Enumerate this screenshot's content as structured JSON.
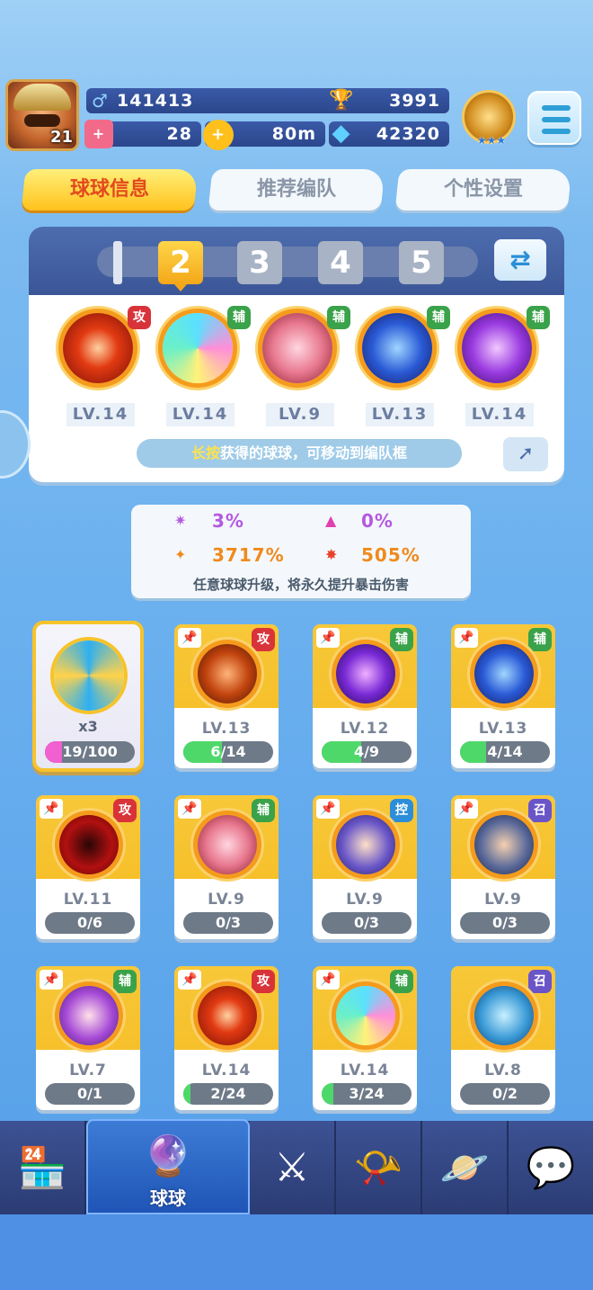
{
  "player": {
    "level": "21",
    "id": "141413",
    "trophies": "3991",
    "tickets": "28",
    "distance": "80m",
    "gems": "42320"
  },
  "tabs": [
    "球球信息",
    "推荐编队",
    "个性设置"
  ],
  "lineup": {
    "slots": [
      "1",
      "2",
      "3",
      "4",
      "5"
    ],
    "active_slot": "2",
    "balls": [
      {
        "type": "攻",
        "level": "LV.14"
      },
      {
        "type": "辅",
        "level": "LV.14"
      },
      {
        "type": "辅",
        "level": "LV.9"
      },
      {
        "type": "辅",
        "level": "LV.13"
      },
      {
        "type": "辅",
        "level": "LV.14"
      }
    ],
    "hint_highlight": "长按",
    "hint_text": "获得的球球，可移动到编队框"
  },
  "crit": {
    "stat1": "3%",
    "stat2": "0%",
    "stat3": "3717%",
    "stat4": "505%",
    "tip": "任意球球升级，将永久提升暴击伤害"
  },
  "special_card": {
    "count": "x3",
    "progress": "19/100"
  },
  "cards": [
    {
      "type": "攻",
      "level": "LV.13",
      "progress": "6/14",
      "ratio": 0.43
    },
    {
      "type": "辅",
      "level": "LV.12",
      "progress": "4/9",
      "ratio": 0.44
    },
    {
      "type": "辅",
      "level": "LV.13",
      "progress": "4/14",
      "ratio": 0.29
    },
    {
      "type": "攻",
      "level": "LV.11",
      "progress": "0/6",
      "ratio": 0
    },
    {
      "type": "辅",
      "level": "LV.9",
      "progress": "0/3",
      "ratio": 0
    },
    {
      "type": "控",
      "level": "LV.9",
      "progress": "0/3",
      "ratio": 0
    },
    {
      "type": "召",
      "level": "LV.9",
      "progress": "0/3",
      "ratio": 0
    },
    {
      "type": "辅",
      "level": "LV.7",
      "progress": "0/1",
      "ratio": 0
    },
    {
      "type": "攻",
      "level": "LV.14",
      "progress": "2/24",
      "ratio": 0.08
    },
    {
      "type": "辅",
      "level": "LV.14",
      "progress": "3/24",
      "ratio": 0.13
    },
    {
      "type": "召",
      "level": "LV.8",
      "progress": "0/2",
      "ratio": 0
    }
  ],
  "nav": {
    "active_label": "球球",
    "items": [
      "shop-icon",
      "balls-icon",
      "battle-swords-icon",
      "whistle-icon",
      "planet-icon",
      "chat-heart-icon"
    ]
  },
  "colors": {
    "attack": "#d9333a",
    "support": "#3aa24a",
    "control": "#2c8ed8",
    "summon": "#6a55c8",
    "accent_gold": "#ffc21c"
  }
}
